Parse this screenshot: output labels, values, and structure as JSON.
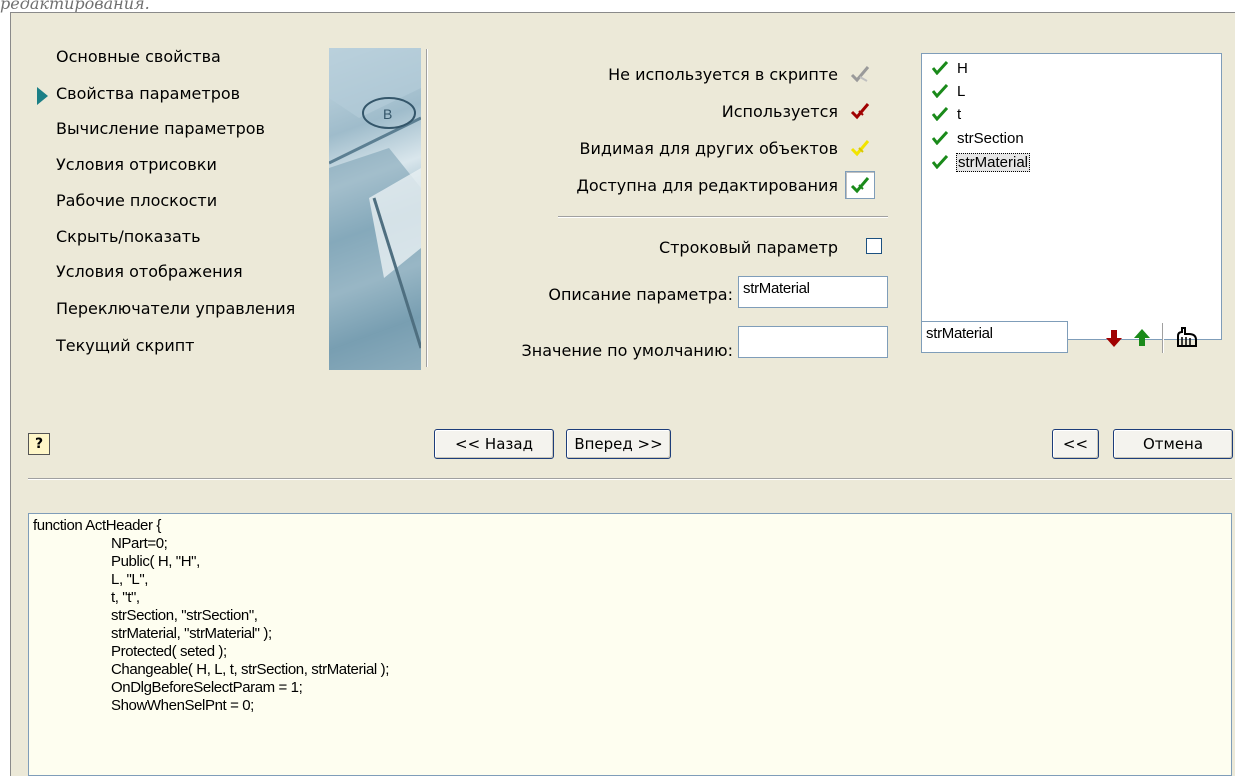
{
  "page_caption": "редактирования.",
  "nav": {
    "items": [
      {
        "label": "Основные свойства"
      },
      {
        "label": "Свойства параметров",
        "active": true
      },
      {
        "label": "Вычисление параметров"
      },
      {
        "label": "Условия отрисовки"
      },
      {
        "label": "Рабочие плоскости"
      },
      {
        "label": "Скрыть/показать"
      },
      {
        "label": "Условия отображения"
      },
      {
        "label": "Переключатели управления"
      },
      {
        "label": "Текущий скрипт"
      }
    ]
  },
  "banner": {
    "label": "B"
  },
  "status_options": [
    {
      "label": "Не используется в скрипте",
      "icon": "unused-check-icon",
      "color": "#9a9a9a"
    },
    {
      "label": "Используется",
      "icon": "used-check-icon",
      "color": "#a00000"
    },
    {
      "label": "Видимая для других объектов",
      "icon": "visible-check-icon",
      "color": "#f2e400"
    },
    {
      "label": "Доступна для редактирования",
      "icon": "editable-check-icon",
      "color": "#1a8a1a",
      "selected": true
    }
  ],
  "string_param": {
    "label": "Строковый параметр",
    "checked": false
  },
  "description": {
    "label": "Описание параметра:",
    "value": "strMaterial"
  },
  "default_value": {
    "label": "Значение по умолчанию:",
    "value": ""
  },
  "params_list": {
    "items": [
      {
        "name": "H"
      },
      {
        "name": "L"
      },
      {
        "name": "t"
      },
      {
        "name": "strSection"
      },
      {
        "name": "strMaterial",
        "selected": true
      }
    ],
    "edit_value": "strMaterial"
  },
  "buttons": {
    "back": "<< Назад",
    "next": "Вперед >>",
    "collapse": "<<",
    "cancel": "Отмена",
    "help": "?"
  },
  "code": {
    "lines": [
      {
        "text": "function ActHeader {",
        "indent": false
      },
      {
        "text": "NPart=0;",
        "indent": true
      },
      {
        "text": "Public( H, \"H\",",
        "indent": true
      },
      {
        "text": "L, \"L\",",
        "indent": true
      },
      {
        "text": "t, \"t\",",
        "indent": true
      },
      {
        "text": "strSection, \"strSection\",",
        "indent": true
      },
      {
        "text": "strMaterial, \"strMaterial\" );",
        "indent": true
      },
      {
        "text": "Protected( seted );",
        "indent": true
      },
      {
        "text": "Changeable( H, L, t, strSection, strMaterial );",
        "indent": true
      },
      {
        "text": "OnDlgBeforeSelectParam = 1;",
        "indent": true
      },
      {
        "text": "ShowWhenSelPnt = 0;",
        "indent": true
      }
    ]
  },
  "colors": {
    "dialog_bg": "#ece9d8",
    "accent_marker": "#1b7f86",
    "check_green": "#1a8a1a",
    "arrow_down": "#a00000",
    "arrow_up": "#1a8a1a"
  }
}
